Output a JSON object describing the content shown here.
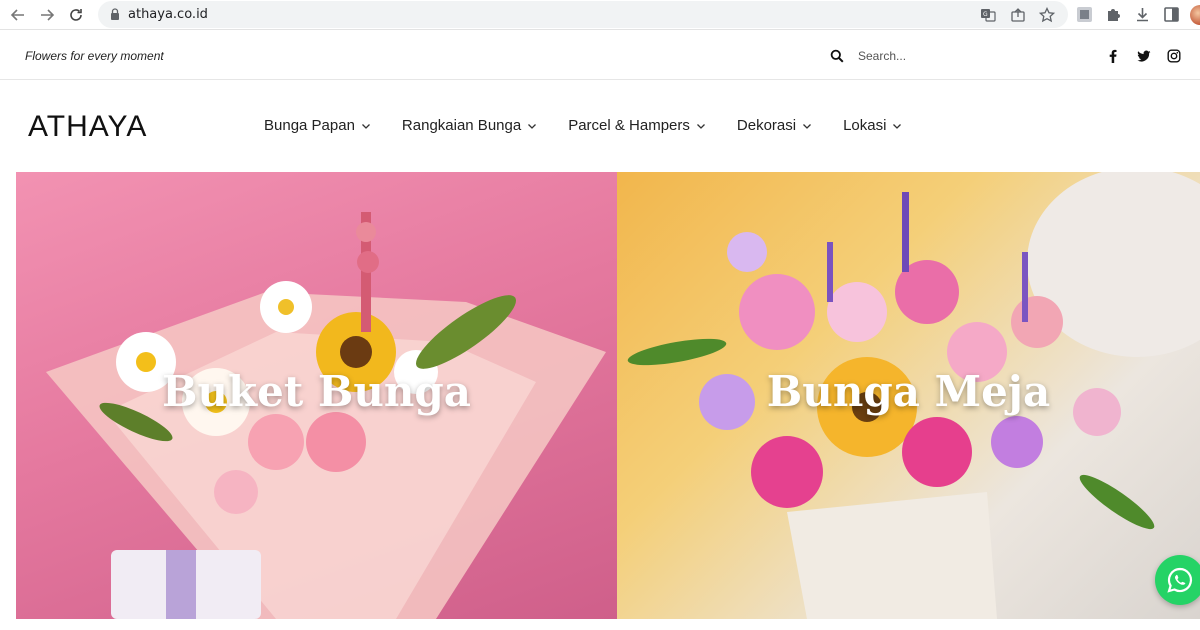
{
  "browser": {
    "url": "athaya.co.id",
    "icons": [
      "back-icon",
      "forward-icon",
      "reload-icon",
      "lock-icon",
      "translate-icon",
      "share-icon",
      "star-icon",
      "extension-icon",
      "puzzle-icon",
      "download-icon",
      "sidepanel-icon"
    ]
  },
  "topbar": {
    "tagline": "Flowers for every moment",
    "search_placeholder": "Search...",
    "social": [
      "facebook-icon",
      "twitter-icon",
      "instagram-icon"
    ]
  },
  "header": {
    "logo": "ATHAYA",
    "menu": [
      {
        "label": "Bunga Papan"
      },
      {
        "label": "Rangkaian Bunga"
      },
      {
        "label": "Parcel & Hampers"
      },
      {
        "label": "Dekorasi"
      },
      {
        "label": "Lokasi"
      }
    ]
  },
  "hero": {
    "left_title": "Buket Bunga",
    "right_title": "Bunga Meja"
  },
  "colors": {
    "left_bg": "#e5799f",
    "right_bg": "#f2b64c",
    "whatsapp": "#25d366"
  }
}
